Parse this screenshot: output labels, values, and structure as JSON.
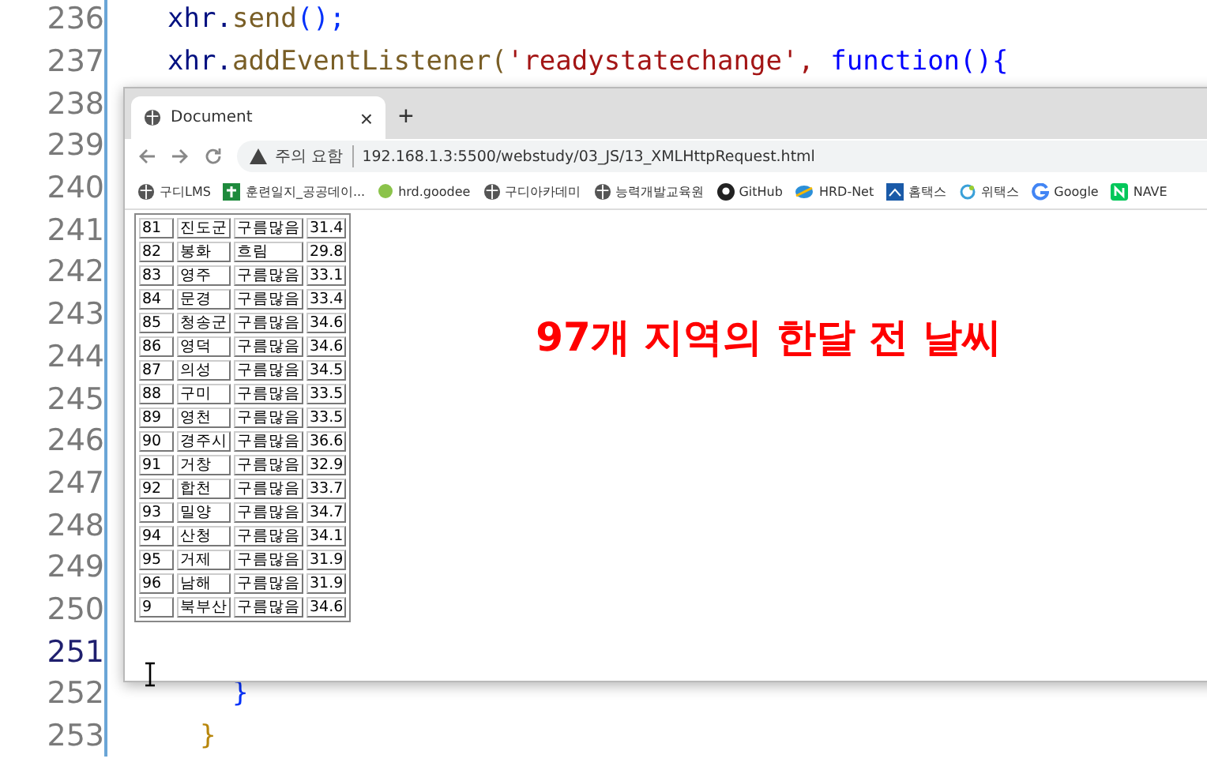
{
  "editor": {
    "lines": [
      {
        "number": "236",
        "current": false,
        "tokens": [
          {
            "text": "xhr.",
            "kind": "var"
          },
          {
            "text": "send",
            "kind": "fn"
          },
          {
            "text": "();",
            "kind": "paren"
          }
        ]
      },
      {
        "number": "237",
        "current": false,
        "tokens": [
          {
            "text": "xhr.",
            "kind": "var"
          },
          {
            "text": "addEventListener(",
            "kind": "fn"
          },
          {
            "text": "'readystatechange',",
            "kind": "str"
          },
          {
            "text": " function(){",
            "kind": "kw"
          }
        ]
      },
      {
        "number": "238",
        "current": false
      },
      {
        "number": "239",
        "current": false
      },
      {
        "number": "240",
        "current": false
      },
      {
        "number": "241",
        "current": false
      },
      {
        "number": "242",
        "current": false
      },
      {
        "number": "243",
        "current": false
      },
      {
        "number": "244",
        "current": false
      },
      {
        "number": "245",
        "current": false
      },
      {
        "number": "246",
        "current": false
      },
      {
        "number": "247",
        "current": false
      },
      {
        "number": "248",
        "current": false
      },
      {
        "number": "249",
        "current": false
      },
      {
        "number": "250",
        "current": false
      },
      {
        "number": "251",
        "current": true
      },
      {
        "number": "252",
        "current": false,
        "tokens": [
          {
            "text": "    }",
            "kind": "paren"
          }
        ]
      },
      {
        "number": "253",
        "current": false,
        "tokens": [
          {
            "text": "  }",
            "kind": "brace"
          }
        ]
      }
    ]
  },
  "browser": {
    "tab": {
      "title": "Document",
      "close": "×"
    },
    "new_tab": "+",
    "address": {
      "security": "주의 요함",
      "url": "192.168.1.3:5500/webstudy/03_JS/13_XMLHttpRequest.html"
    },
    "bookmarks": [
      {
        "label": "구디LMS",
        "kind": "globe"
      },
      {
        "label": "훈련일지_공공데이...",
        "kind": "cross"
      },
      {
        "label": "hrd.goodee",
        "kind": "dot"
      },
      {
        "label": "구디아카데미",
        "kind": "globe"
      },
      {
        "label": "능력개발교육원",
        "kind": "globe"
      },
      {
        "label": "GitHub",
        "kind": "github"
      },
      {
        "label": "HRD-Net",
        "kind": "hrd"
      },
      {
        "label": "홈택스",
        "kind": "hometax"
      },
      {
        "label": "위택스",
        "kind": "wetax"
      },
      {
        "label": "Google",
        "kind": "google"
      },
      {
        "label": "NAVE",
        "kind": "naver"
      }
    ],
    "table": {
      "rows": [
        [
          "81",
          "진도군",
          "구름많음",
          "31.4"
        ],
        [
          "82",
          "봉화",
          "흐림",
          "29.8"
        ],
        [
          "83",
          "영주",
          "구름많음",
          "33.1"
        ],
        [
          "84",
          "문경",
          "구름많음",
          "33.4"
        ],
        [
          "85",
          "청송군",
          "구름많음",
          "34.6"
        ],
        [
          "86",
          "영덕",
          "구름많음",
          "34.6"
        ],
        [
          "87",
          "의성",
          "구름많음",
          "34.5"
        ],
        [
          "88",
          "구미",
          "구름많음",
          "33.5"
        ],
        [
          "89",
          "영천",
          "구름많음",
          "33.5"
        ],
        [
          "90",
          "경주시",
          "구름많음",
          "36.6"
        ],
        [
          "91",
          "거창",
          "구름많음",
          "32.9"
        ],
        [
          "92",
          "합천",
          "구름많음",
          "33.7"
        ],
        [
          "93",
          "밀양",
          "구름많음",
          "34.7"
        ],
        [
          "94",
          "산청",
          "구름많음",
          "34.1"
        ],
        [
          "95",
          "거제",
          "구름많음",
          "31.9"
        ],
        [
          "96",
          "남해",
          "구름많음",
          "31.9"
        ],
        [
          "9",
          "북부산",
          "구름많음",
          "34.6"
        ]
      ]
    },
    "heading": "97개 지역의 한달 전 날씨"
  }
}
